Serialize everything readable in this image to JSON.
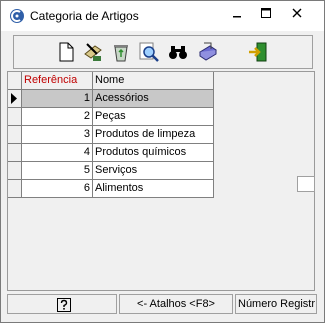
{
  "window": {
    "title": "Categoria de Artigos"
  },
  "toolbar": {
    "buttons": [
      {
        "icon": "new-document-icon"
      },
      {
        "icon": "edit-icon"
      },
      {
        "icon": "recycle-delete-icon"
      },
      {
        "icon": "magnifier-search-icon"
      },
      {
        "icon": "binoculars-find-icon"
      },
      {
        "icon": "print-icon"
      },
      {
        "icon": "exit-door-icon"
      }
    ]
  },
  "table": {
    "columns": [
      "Referência",
      "Nome"
    ],
    "rows": [
      {
        "ref": "1",
        "nome": "Acessórios"
      },
      {
        "ref": "2",
        "nome": "Peças"
      },
      {
        "ref": "3",
        "nome": "Produtos de limpeza"
      },
      {
        "ref": "4",
        "nome": "Produtos químicos"
      },
      {
        "ref": "5",
        "nome": "Serviços"
      },
      {
        "ref": "6",
        "nome": "Alimentos"
      }
    ],
    "selected_row": 1
  },
  "statusbar": {
    "help_icon": "help-question-icon",
    "atalhos": "<- Atalhos <F8>",
    "numero": "Número Registr"
  },
  "colors": {
    "header_red": "#c00000",
    "selected_row": "#c8c8c8"
  }
}
